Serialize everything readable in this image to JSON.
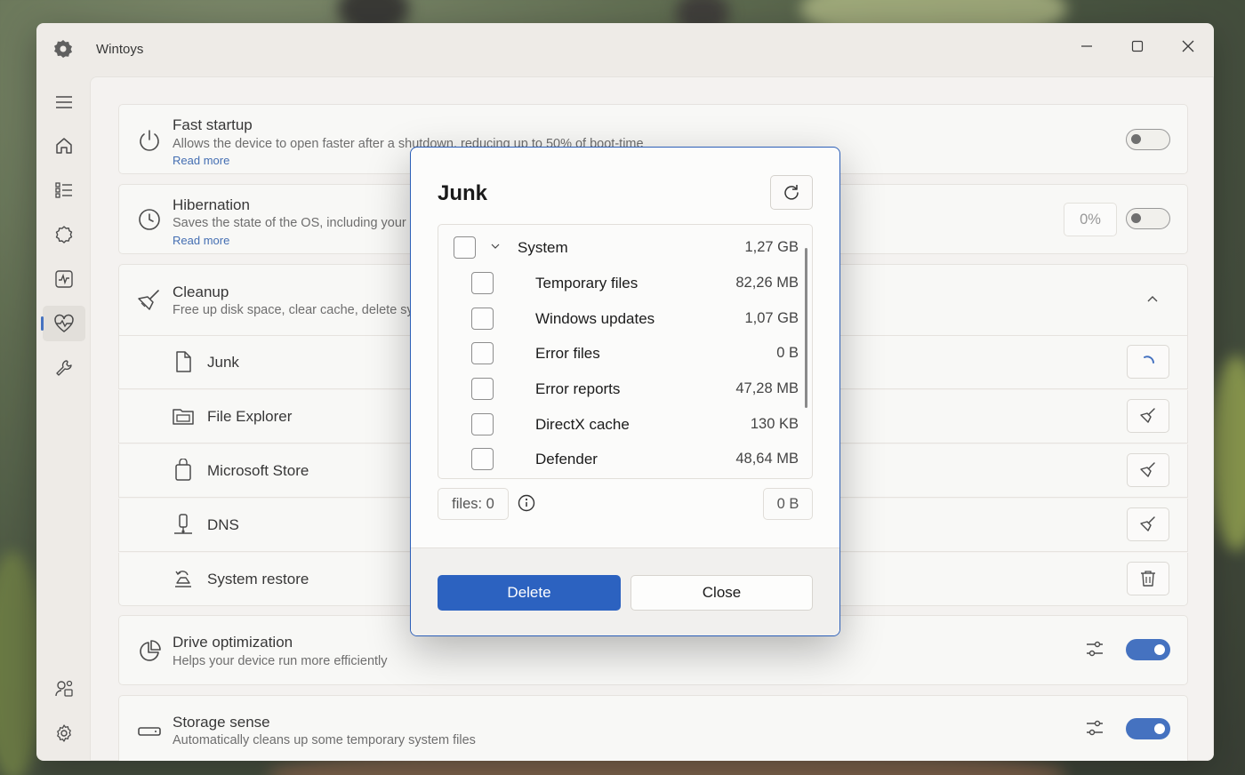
{
  "window": {
    "title": "Wintoys",
    "controls": [
      "minimize",
      "maximize",
      "close"
    ]
  },
  "nav": {
    "items": [
      {
        "name": "menu-icon"
      },
      {
        "name": "home-icon"
      },
      {
        "name": "apps-list-icon"
      },
      {
        "name": "services-icon"
      },
      {
        "name": "performance-icon"
      },
      {
        "name": "health-icon",
        "active": true
      },
      {
        "name": "tools-icon"
      }
    ],
    "bottom": [
      {
        "name": "account-icon"
      },
      {
        "name": "settings-icon"
      }
    ]
  },
  "cards": {
    "fast_startup": {
      "title": "Fast startup",
      "desc": "Allows the device to open faster after a shutdown, reducing up to 50% of boot-time",
      "link": "Read more",
      "toggle": "off"
    },
    "hibernation": {
      "title": "Hibernation",
      "desc": "Saves the state of the OS, including your",
      "link": "Read more",
      "percent": "0%",
      "toggle": "off"
    },
    "cleanup": {
      "title": "Cleanup",
      "desc": "Free up disk space, clear cache, delete sy",
      "items": [
        {
          "label": "Junk",
          "action": "loading"
        },
        {
          "label": "File Explorer",
          "action": "broom"
        },
        {
          "label": "Microsoft Store",
          "action": "broom"
        },
        {
          "label": "DNS",
          "action": "broom"
        },
        {
          "label": "System restore",
          "action": "trash"
        }
      ]
    },
    "drive_optimization": {
      "title": "Drive optimization",
      "desc": "Helps your device run more efficiently",
      "toggle": "on"
    },
    "storage_sense": {
      "title": "Storage sense",
      "desc": "Automatically cleans up some temporary system files",
      "toggle": "on"
    }
  },
  "dialog": {
    "title": "Junk",
    "tree": {
      "parent": {
        "label": "System",
        "size": "1,27 GB"
      },
      "children": [
        {
          "label": "Temporary files",
          "size": "82,26 MB"
        },
        {
          "label": "Windows updates",
          "size": "1,07 GB"
        },
        {
          "label": "Error files",
          "size": "0 B"
        },
        {
          "label": "Error reports",
          "size": "47,28 MB"
        },
        {
          "label": "DirectX cache",
          "size": "130 KB"
        },
        {
          "label": "Defender",
          "size": "48,64 MB"
        }
      ]
    },
    "files_count": "files: 0",
    "total_size": "0 B",
    "delete_label": "Delete",
    "close_label": "Close"
  },
  "colors": {
    "accent": "#2c5fb8",
    "primary_button": "#2c62c0",
    "window_bg": "#ece9e4",
    "card_bg": "#f8f7f5"
  }
}
